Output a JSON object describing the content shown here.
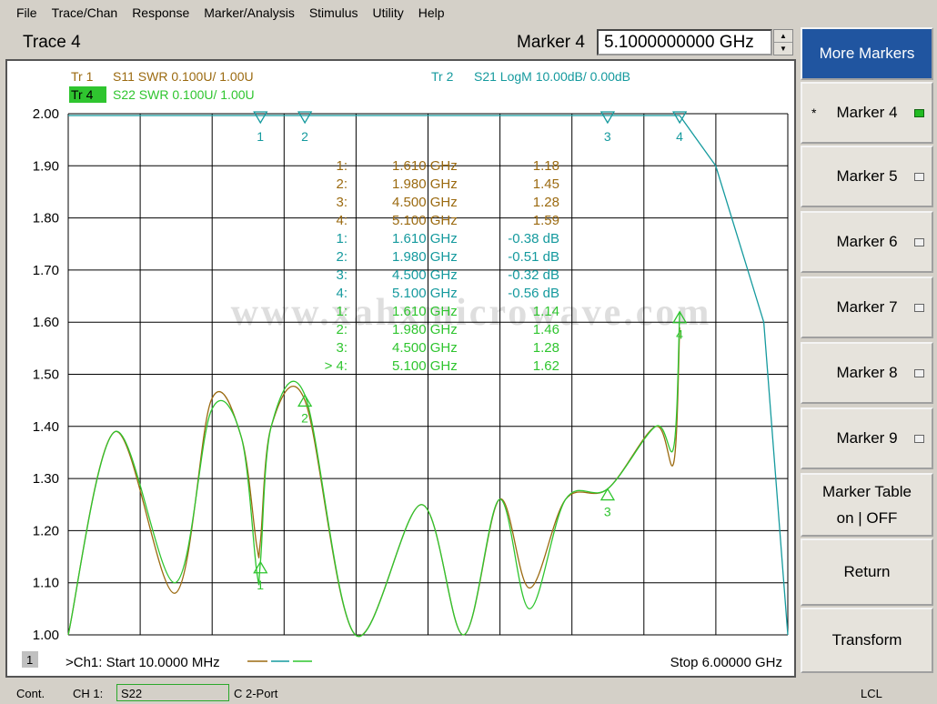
{
  "menu": [
    "File",
    "Trace/Chan",
    "Response",
    "Marker/Analysis",
    "Stimulus",
    "Utility",
    "Help"
  ],
  "header": {
    "trace_title": "Trace 4",
    "marker_label": "Marker 4",
    "marker_value": "5.1000000000 GHz"
  },
  "colors": {
    "tr1": "#9b6a10",
    "tr2": "#159a9e",
    "tr4": "#2fc52f",
    "grid": "#000000",
    "softkey_primary": "#2055a0"
  },
  "traces": {
    "tr1_num": "Tr  1",
    "tr1_label": "S11 SWR 0.100U/  1.00U",
    "tr2_num": "Tr  2",
    "tr2_label": "S21 LogM 10.00dB/  0.00dB",
    "tr4_num": "Tr  4",
    "tr4_label": "S22 SWR 0.100U/  1.00U"
  },
  "y_ticks": [
    "2.00",
    "1.90",
    "1.80",
    "1.70",
    "1.60",
    "1.50",
    "1.40",
    "1.30",
    "1.20",
    "1.10",
    "1.00"
  ],
  "marker_table": [
    {
      "id": "1:",
      "freq": "1.610 GHz",
      "val": "1.18",
      "trace": "tr1"
    },
    {
      "id": "2:",
      "freq": "1.980 GHz",
      "val": "1.45",
      "trace": "tr1"
    },
    {
      "id": "3:",
      "freq": "4.500 GHz",
      "val": "1.28",
      "trace": "tr1"
    },
    {
      "id": "4:",
      "freq": "5.100 GHz",
      "val": "1.59",
      "trace": "tr1"
    },
    {
      "id": "1:",
      "freq": "1.610 GHz",
      "val": "-0.38 dB",
      "trace": "tr2"
    },
    {
      "id": "2:",
      "freq": "1.980 GHz",
      "val": "-0.51 dB",
      "trace": "tr2"
    },
    {
      "id": "3:",
      "freq": "4.500 GHz",
      "val": "-0.32 dB",
      "trace": "tr2"
    },
    {
      "id": "4:",
      "freq": "5.100 GHz",
      "val": "-0.56 dB",
      "trace": "tr2"
    },
    {
      "id": "1:",
      "freq": "1.610 GHz",
      "val": "1.14",
      "trace": "tr4"
    },
    {
      "id": "2:",
      "freq": "1.980 GHz",
      "val": "1.46",
      "trace": "tr4"
    },
    {
      "id": "3:",
      "freq": "4.500 GHz",
      "val": "1.28",
      "trace": "tr4"
    },
    {
      "id": "> 4:",
      "freq": "5.100 GHz",
      "val": "1.62",
      "trace": "tr4"
    }
  ],
  "watermark": "www.xahxmicrowave.com",
  "footer": {
    "channel_num": "1",
    "start": ">Ch1: Start  10.0000 MHz",
    "stop": "Stop  6.00000 GHz"
  },
  "softkeys": [
    {
      "label": "More Markers",
      "active": false
    },
    {
      "label": "Marker 4",
      "active": true
    },
    {
      "label": "Marker 5",
      "active": false
    },
    {
      "label": "Marker 6",
      "active": false
    },
    {
      "label": "Marker 7",
      "active": false
    },
    {
      "label": "Marker 8",
      "active": false
    },
    {
      "label": "Marker 9",
      "active": false
    },
    {
      "label": "Marker Table on | OFF",
      "active": false
    },
    {
      "label": "Return",
      "active": false
    },
    {
      "label": "Transform",
      "active": false
    }
  ],
  "status": {
    "mode": "Cont.",
    "channel": "CH 1:",
    "meas": "S22",
    "cal": "C  2-Port",
    "ref": "LCL"
  },
  "chart_data": {
    "type": "line",
    "xlim_ghz": [
      0.01,
      6.0
    ],
    "ylim": [
      1.0,
      2.0
    ],
    "ylabel_unit": "SWR",
    "series": [
      {
        "name": "S11 SWR",
        "x": [
          0.01,
          0.4,
          0.9,
          1.2,
          1.45,
          1.58,
          1.61,
          1.7,
          1.98,
          2.4,
          2.95,
          3.3,
          3.6,
          3.85,
          4.15,
          4.5,
          4.9,
          5.05,
          5.1
        ],
        "y": [
          1.0,
          1.39,
          1.08,
          1.45,
          1.38,
          1.17,
          1.18,
          1.4,
          1.45,
          1.0,
          1.25,
          1.0,
          1.26,
          1.09,
          1.26,
          1.28,
          1.4,
          1.33,
          1.59
        ]
      },
      {
        "name": "S21 LogM",
        "x": [
          0.01,
          5.1,
          5.4,
          5.8,
          6.0
        ],
        "y_db": [
          -0.5,
          -0.56,
          -10,
          -40,
          -100
        ]
      },
      {
        "name": "S22 SWR",
        "x": [
          0.01,
          0.4,
          0.9,
          1.2,
          1.45,
          1.58,
          1.61,
          1.7,
          1.98,
          2.4,
          2.95,
          3.3,
          3.6,
          3.85,
          4.15,
          4.5,
          4.9,
          5.05,
          5.1
        ],
        "y": [
          1.0,
          1.39,
          1.1,
          1.43,
          1.38,
          1.12,
          1.14,
          1.4,
          1.46,
          1.0,
          1.25,
          1.0,
          1.26,
          1.05,
          1.26,
          1.28,
          1.4,
          1.36,
          1.62
        ]
      }
    ],
    "markers": [
      {
        "id": "1",
        "x_ghz": 1.61
      },
      {
        "id": "2",
        "x_ghz": 1.98
      },
      {
        "id": "3",
        "x_ghz": 4.5
      },
      {
        "id": "4",
        "x_ghz": 5.1
      }
    ]
  }
}
